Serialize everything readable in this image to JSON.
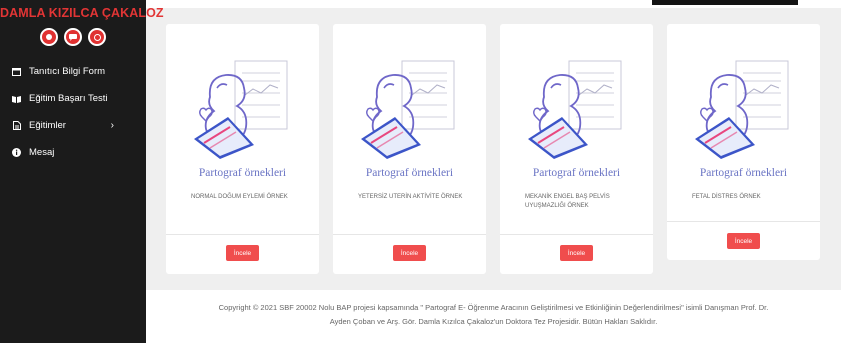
{
  "sidebar": {
    "brand": "DAMLA KIZILCA ÇAKALOZ",
    "brand_icons": [
      "gear-icon",
      "chat-icon",
      "power-icon"
    ],
    "items": [
      {
        "label": "Tanıtıcı Bilgi Form",
        "icon": "form-icon"
      },
      {
        "label": "Eğitim Başarı Testi",
        "icon": "book-icon"
      },
      {
        "label": "Eğitimler",
        "icon": "document-icon",
        "caret": "›"
      },
      {
        "label": "Mesaj",
        "icon": "info-icon"
      }
    ]
  },
  "cards": [
    {
      "title": "Partograf örnekleri",
      "description": "NORMAL DOĞUM EYLEMİ ÖRNEK",
      "button": "İncele"
    },
    {
      "title": "Partograf örnekleri",
      "description": "YETERSİZ UTERİN AKTİVİTE ÖRNEK",
      "button": "İncele"
    },
    {
      "title": "Partograf örnekleri",
      "description": "MEKANİK ENGEL BAŞ PELVİS UYUŞMAZLIĞI ÖRNEK",
      "button": "İncele"
    },
    {
      "title": "Partograf örnekleri",
      "description": "FETAL DİSTRES ÖRNEK",
      "button": "İncele"
    }
  ],
  "footer": {
    "line1": "Copyright © 2021 SBF 20002 Nolu BAP projesi kapsamında \" Partograf E- Öğrenme Aracının Geliştirilmesi ve Etkinliğinin Değerlendirilmesi\" isimli Danışman Prof. Dr.",
    "line2": "Ayden Çoban ve Arş. Gör. Damla Kızılca Çakaloz'un Doktora Tez Projesidir. Bütün Hakları Saklıdır."
  },
  "colors": {
    "sidebar_bg": "#1b1b1b",
    "brand": "#e23535",
    "button": "#f04d4d",
    "card_title": "#6a74c4",
    "content_bg": "#efefef"
  }
}
